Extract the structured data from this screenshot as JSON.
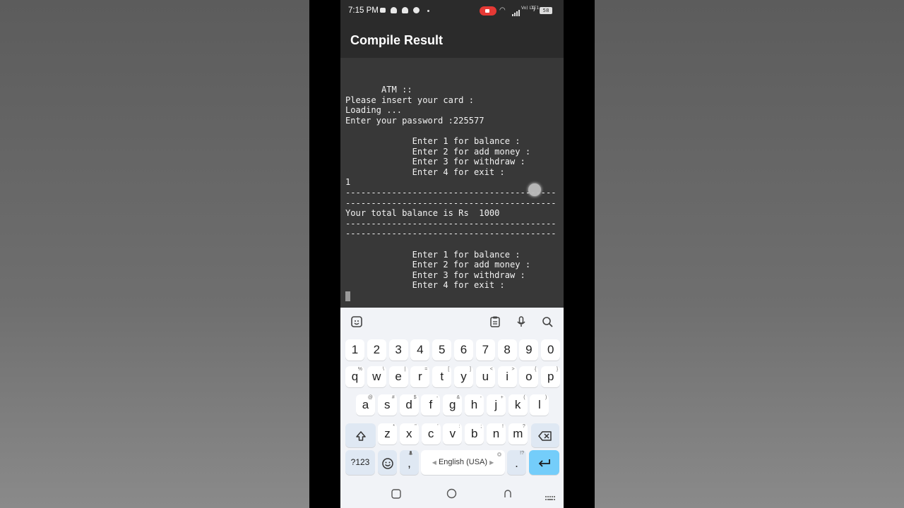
{
  "status_bar": {
    "time": "7:15 PM",
    "battery": "58",
    "network": "Vo) LTE1"
  },
  "app_bar": {
    "title": "Compile Result"
  },
  "console": {
    "output": "       ATM ::\nPlease insert your card :\nLoading ...\nEnter your password :225577\n\n             Enter 1 for balance :\n             Enter 2 for add money :\n             Enter 3 for withdraw :\n             Enter 4 for exit :\n1\n-----------------------------------------\n-----------------------------------------\nYour total balance is Rs  1000\n-----------------------------------------\n-----------------------------------------\n\n             Enter 1 for balance :\n             Enter 2 for add money :\n             Enter 3 for withdraw :\n             Enter 4 for exit :"
  },
  "keyboard": {
    "toolbar_icons": [
      "sticker-icon",
      "clipboard-icon",
      "microphone-icon",
      "search-icon"
    ],
    "number_row": [
      "1",
      "2",
      "3",
      "4",
      "5",
      "6",
      "7",
      "8",
      "9",
      "0"
    ],
    "row1": [
      {
        "k": "q",
        "s": "%"
      },
      {
        "k": "w",
        "s": "\\"
      },
      {
        "k": "e",
        "s": "|"
      },
      {
        "k": "r",
        "s": "="
      },
      {
        "k": "t",
        "s": "["
      },
      {
        "k": "y",
        "s": "]"
      },
      {
        "k": "u",
        "s": "<"
      },
      {
        "k": "i",
        "s": ">"
      },
      {
        "k": "o",
        "s": "{"
      },
      {
        "k": "p",
        "s": "}"
      }
    ],
    "row2": [
      {
        "k": "a",
        "s": "@"
      },
      {
        "k": "s",
        "s": "#"
      },
      {
        "k": "d",
        "s": "$"
      },
      {
        "k": "f",
        "s": "-"
      },
      {
        "k": "g",
        "s": "&"
      },
      {
        "k": "h",
        "s": "-"
      },
      {
        "k": "j",
        "s": "+"
      },
      {
        "k": "k",
        "s": "("
      },
      {
        "k": "l",
        "s": ")"
      }
    ],
    "row3": [
      {
        "k": "z",
        "s": "*"
      },
      {
        "k": "x",
        "s": "\""
      },
      {
        "k": "c",
        "s": "'"
      },
      {
        "k": "v",
        "s": ":"
      },
      {
        "k": "b",
        "s": ";"
      },
      {
        "k": "n",
        "s": "!"
      },
      {
        "k": "m",
        "s": "?"
      }
    ],
    "symbols_label": "?123",
    "comma_label": ",",
    "space_label": "English (USA)",
    "period_label": ".",
    "period_sub": "!?"
  }
}
